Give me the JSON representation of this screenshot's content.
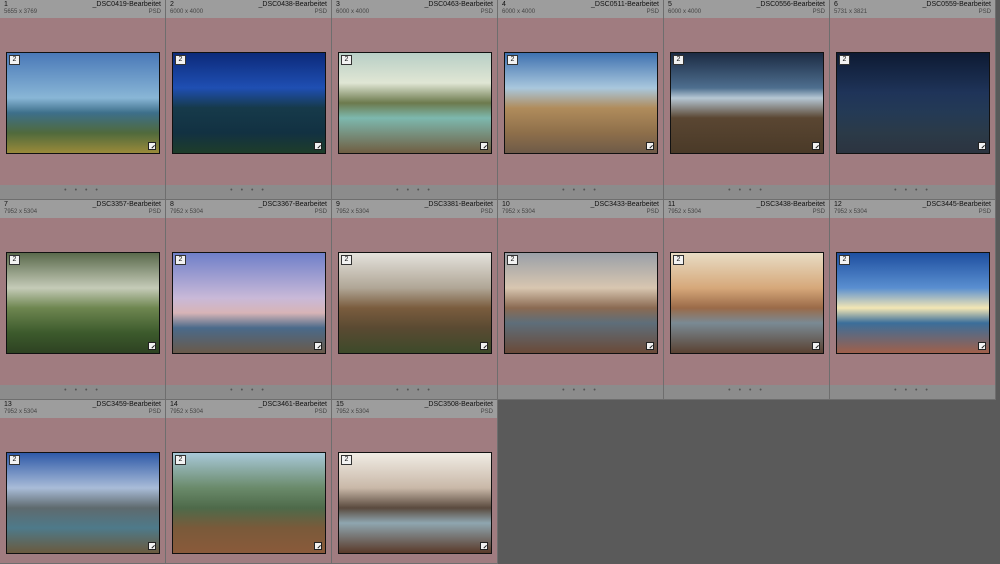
{
  "library": {
    "cells": [
      {
        "num": "1",
        "name": "_DSC0419-Bearbeitet",
        "dims": "5655 x 3769",
        "ext": "PSD",
        "stack": "2",
        "gradient": "linear-gradient(180deg,#4a79b8 0%,#89b6d6 45%,#3d6f8a 60%,#506a3c 80%,#9a8a3a 100%)"
      },
      {
        "num": "2",
        "name": "_DSC0438-Bearbeitet",
        "dims": "6000 x 4000",
        "ext": "PSD",
        "stack": "2",
        "gradient": "linear-gradient(180deg,#0c2a7a 0%,#1f4fb3 35%,#163a4a 55%,#123142 80%,#1e3d2a 100%)"
      },
      {
        "num": "3",
        "name": "_DSC0463-Bearbeitet",
        "dims": "6000 x 4000",
        "ext": "PSD",
        "stack": "2",
        "gradient": "linear-gradient(180deg,#b8cfc6 0%,#e0e6d4 30%,#6c7a4d 50%,#7db8ae 65%,#705e42 100%)"
      },
      {
        "num": "4",
        "name": "_DSC0511-Bearbeitet",
        "dims": "6000 x 4000",
        "ext": "PSD",
        "stack": "2",
        "gradient": "linear-gradient(180deg,#3f72b0 0%,#a9c7dd 35%,#b08c5c 55%,#8e6f4a 80%,#6e5a48 100%)"
      },
      {
        "num": "5",
        "name": "_DSC0556-Bearbeitet",
        "dims": "6000 x 4000",
        "ext": "PSD",
        "stack": "2",
        "gradient": "linear-gradient(180deg,#1c2b44 0%,#4e6f8f 35%,#b6c7d4 45%,#5a4632 65%,#4a3a28 100%)"
      },
      {
        "num": "6",
        "name": "_DSC0559-Bearbeitet",
        "dims": "5731 x 3821",
        "ext": "PSD",
        "stack": "2",
        "gradient": "linear-gradient(180deg,#0d1a33 0%,#1f3459 40%,#243a55 60%,#2b3a48 80%,#2c3440 100%)"
      },
      {
        "num": "7",
        "name": "_DSC3357-Bearbeitet",
        "dims": "7952 x 5304",
        "ext": "PSD",
        "stack": "2",
        "gradient": "linear-gradient(180deg,#5a6a4c 0%,#c5cbb8 35%,#6e8650 55%,#3c5a2c 80%,#2e4222 100%)"
      },
      {
        "num": "8",
        "name": "_DSC3367-Bearbeitet",
        "dims": "7952 x 5304",
        "ext": "PSD",
        "stack": "2",
        "gradient": "linear-gradient(180deg,#6f7fc9 0%,#c9b9d8 45%,#d7b4b6 60%,#4a6a8a 75%,#6a5a4a 100%)"
      },
      {
        "num": "9",
        "name": "_DSC3381-Bearbeitet",
        "dims": "7952 x 5304",
        "ext": "PSD",
        "stack": "2",
        "gradient": "linear-gradient(180deg,#e4e2dc 0%,#b0a696 35%,#7a5c3e 55%,#5a4a32 75%,#3d4a2a 100%)"
      },
      {
        "num": "10",
        "name": "_DSC3433-Bearbeitet",
        "dims": "7952 x 5304",
        "ext": "PSD",
        "stack": "2",
        "gradient": "linear-gradient(180deg,#9aa0a8 0%,#d8c6b0 35%,#8a6a52 55%,#5e6e7a 70%,#6a4a38 100%)"
      },
      {
        "num": "11",
        "name": "_DSC3438-Bearbeitet",
        "dims": "7952 x 5304",
        "ext": "PSD",
        "stack": "2",
        "gradient": "linear-gradient(180deg,#e8dcc4 0%,#d6a87a 35%,#9a6a48 55%,#7a8a94 70%,#5a4232 100%)"
      },
      {
        "num": "12",
        "name": "_DSC3445-Bearbeitet",
        "dims": "7952 x 5304",
        "ext": "PSD",
        "stack": "2",
        "gradient": "linear-gradient(180deg,#1e4fa0 0%,#5a8fd0 35%,#f3e6b4 55%,#3b6e9a 70%,#a0604a 100%)"
      },
      {
        "num": "13",
        "name": "_DSC3459-Bearbeitet",
        "dims": "7952 x 5304",
        "ext": "PSD",
        "stack": "2",
        "gradient": "linear-gradient(180deg,#2f5aa8 0%,#a9bcd8 35%,#5e6a6e 55%,#4e7a8a 75%,#6a5a3e 100%)"
      },
      {
        "num": "14",
        "name": "_DSC3461-Bearbeitet",
        "dims": "7952 x 5304",
        "ext": "PSD",
        "stack": "2",
        "gradient": "linear-gradient(180deg,#a8c8d8 0%,#6a8a6a 35%,#4e6a4a 55%,#7a5a3a 75%,#8a5a3a 100%)"
      },
      {
        "num": "15",
        "name": "_DSC3508-Bearbeitet",
        "dims": "7952 x 5304",
        "ext": "PSD",
        "stack": "2",
        "gradient": "linear-gradient(180deg,#f0ece4 0%,#c9b8a8 35%,#5a4a3e 55%,#8fa6b0 70%,#5a3a2a 100%)"
      }
    ],
    "foot_dots": "• • • •"
  }
}
